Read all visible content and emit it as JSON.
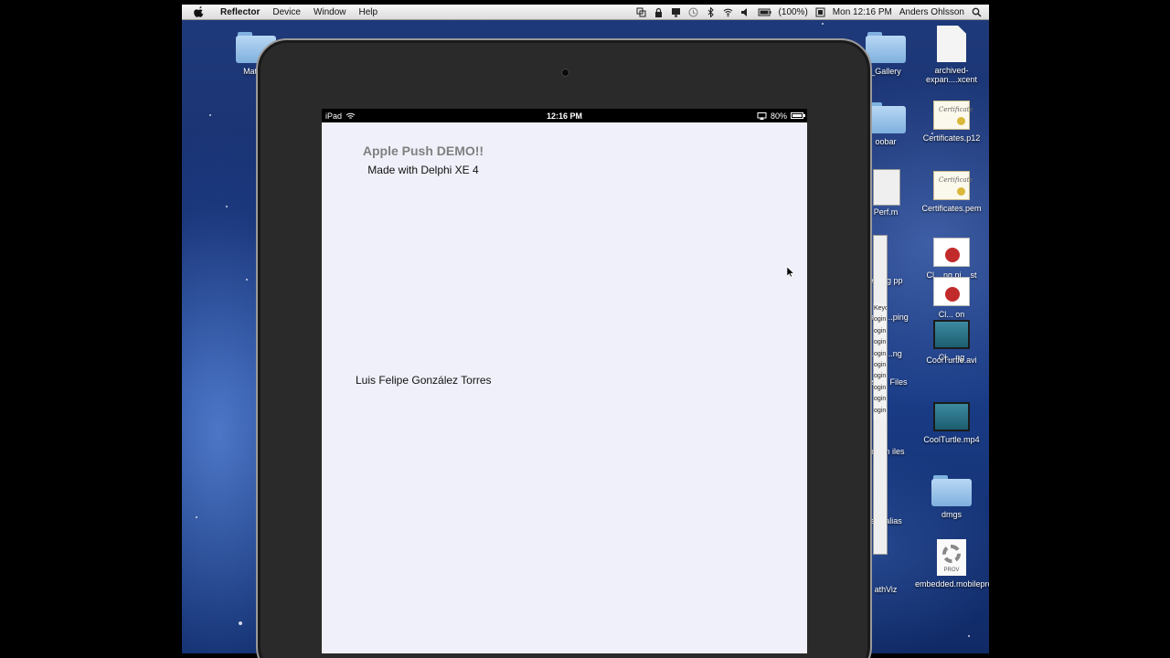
{
  "menubar": {
    "app_name": "Reflector",
    "menus": [
      "Device",
      "Window",
      "Help"
    ],
    "battery": "(100%)",
    "clock": "Mon 12:16 PM",
    "user": "Anders Ohlsson"
  },
  "desktop": {
    "icons": [
      {
        "label": "MathVi"
      },
      {
        "label": "archived-expan....xcent"
      },
      {
        "label": "_Gallery"
      },
      {
        "label": "Certificates.p12"
      },
      {
        "label": "oobar"
      },
      {
        "label": "Certificates.pem"
      },
      {
        "label": "Perf.m"
      },
      {
        "label": "eeting pp"
      },
      {
        "label": "Cl... ng ni... st"
      },
      {
        "label": "ulator ...ping"
      },
      {
        "label": "Cl... on"
      },
      {
        "label": "...or ...ng"
      },
      {
        "label": "Cl... ng"
      },
      {
        "label": "arser_ Files"
      },
      {
        "label": "CoolTurtle.avi"
      },
      {
        "label": "ser_In iles"
      },
      {
        "label": "CoolTurtle.mp4"
      },
      {
        "label": "ech alias"
      },
      {
        "label": "dmgs"
      },
      {
        "label": "athViz"
      },
      {
        "label": "embedded.mobileprovision"
      }
    ],
    "strip_lines": [
      "Keyc",
      "ogin",
      "ogin",
      "ogin",
      "ogin",
      "ogin",
      "ogin",
      "ogin",
      "ogin",
      "ogin"
    ]
  },
  "ipad": {
    "status": {
      "carrier": "iPad",
      "time": "12:16 PM",
      "battery": "80%"
    },
    "app": {
      "title": "Apple Push DEMO!!",
      "subtitle": "Made with Delphi XE 4",
      "name": "Luis Felipe González Torres"
    }
  }
}
